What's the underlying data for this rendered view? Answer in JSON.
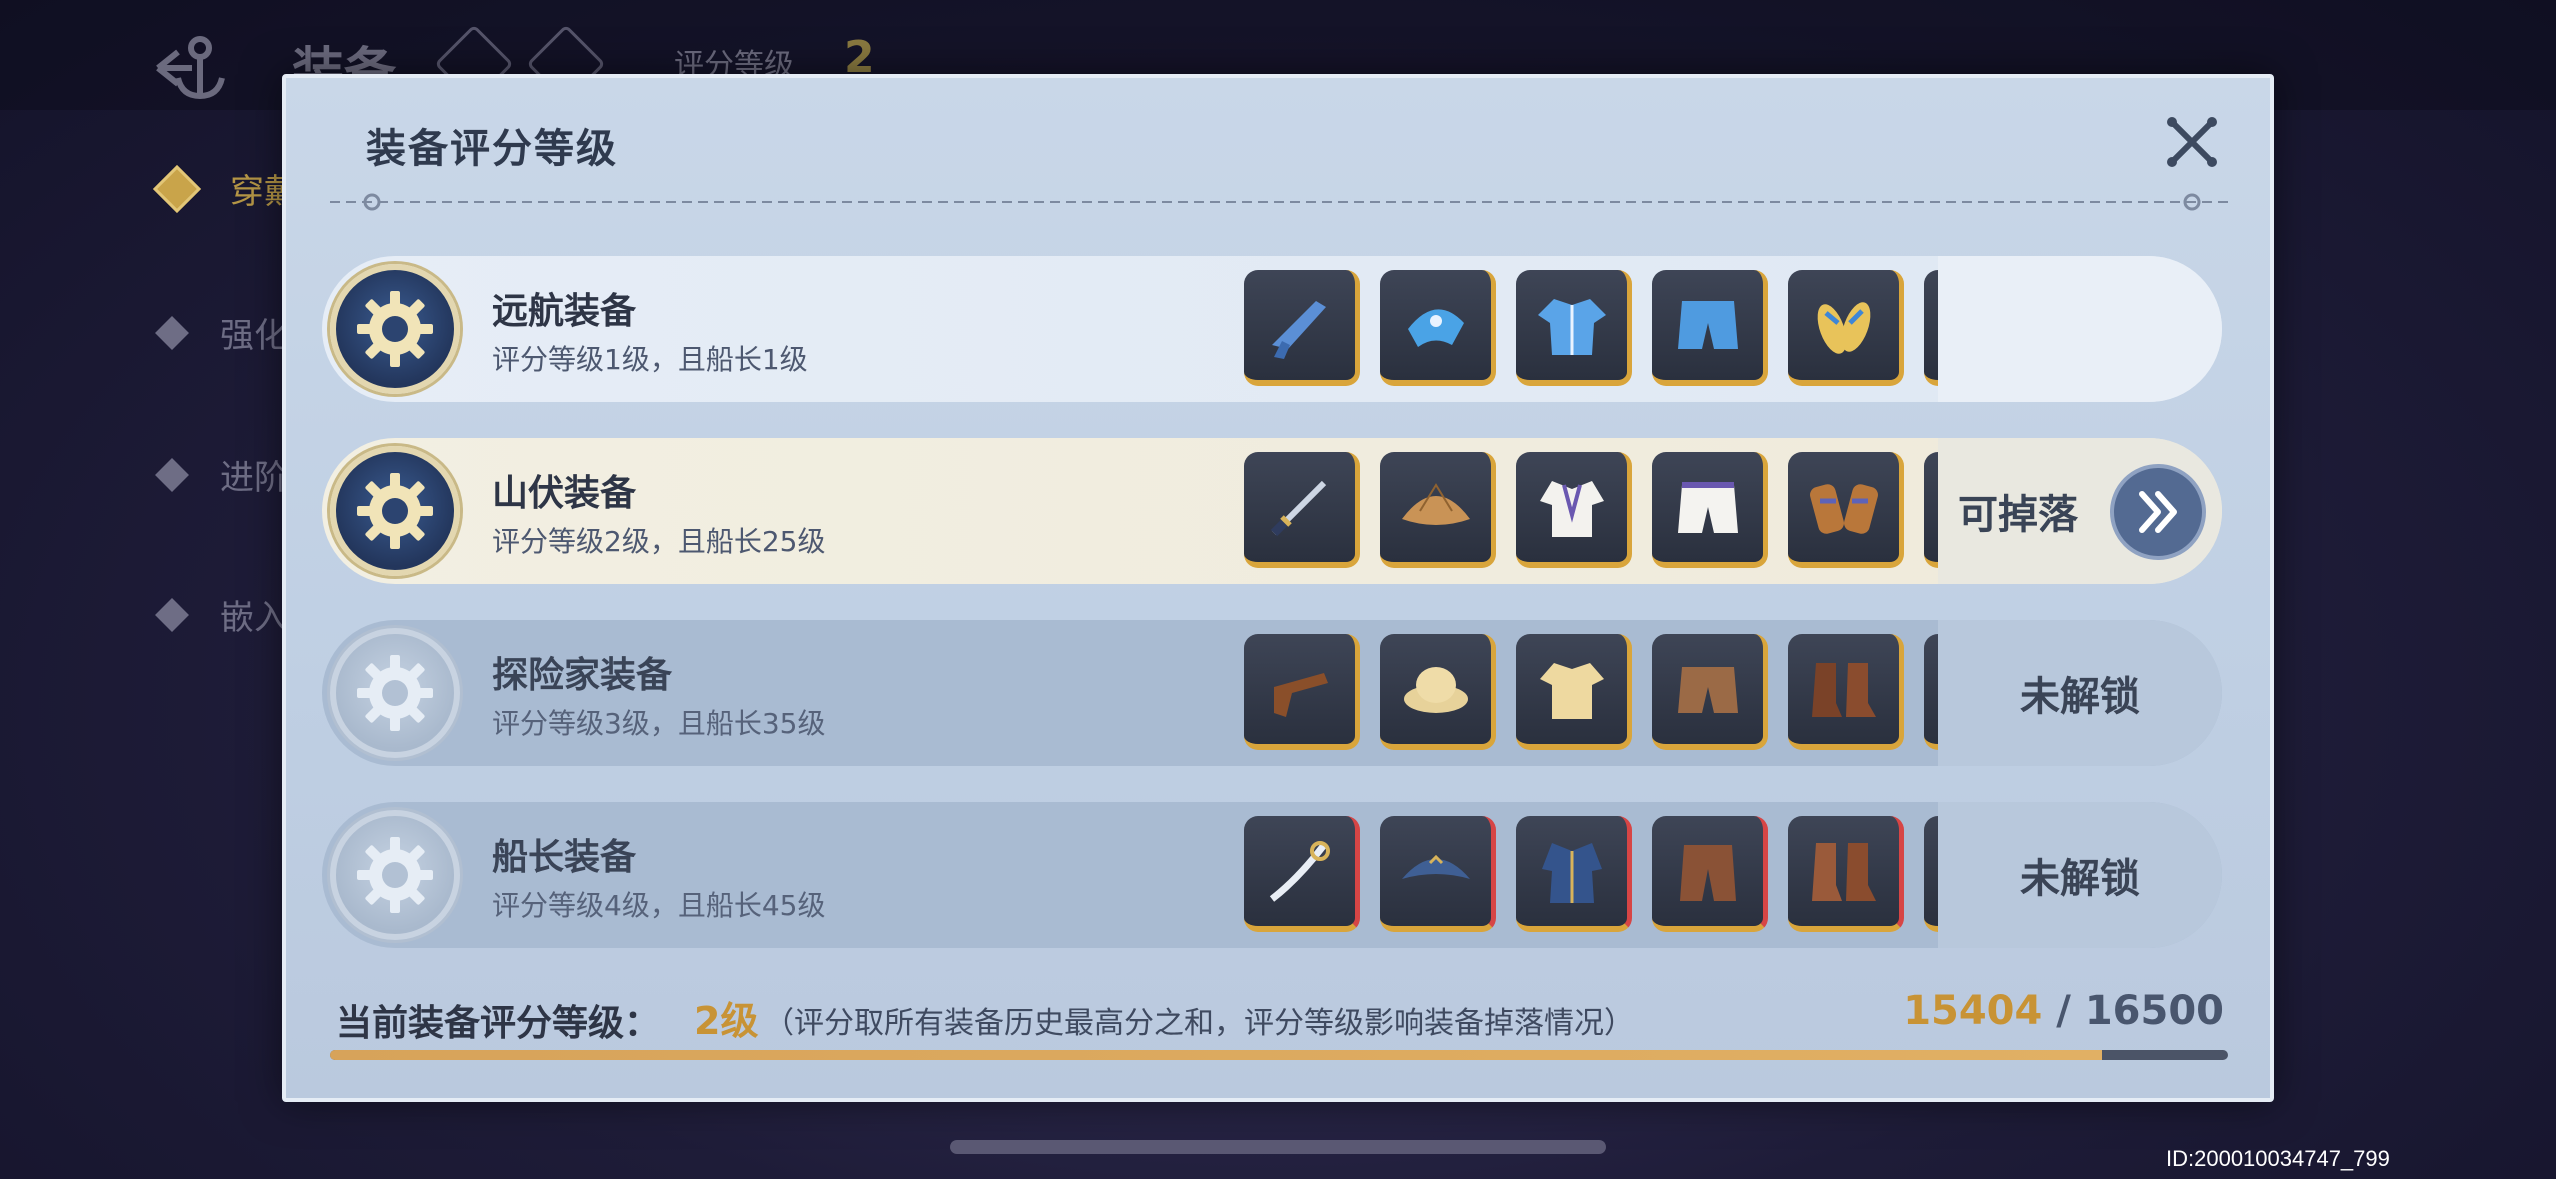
{
  "background": {
    "title": "装备",
    "score_label": "评分等级",
    "score_value": "2",
    "menu": [
      "穿戴",
      "强化",
      "进阶",
      "嵌入"
    ]
  },
  "modal": {
    "title": "装备评分等级",
    "rows": [
      {
        "name": "远航装备",
        "desc": "评分等级1级，且船长1级",
        "unlocked": true,
        "side_text": "",
        "items": [
          "flintlock-pistol-icon",
          "bandana-icon",
          "shirt-icon",
          "shorts-icon",
          "sandals-icon",
          "necklace-icon",
          "pendant-icon"
        ]
      },
      {
        "name": "山伏装备",
        "desc": "评分等级2级，且船长25级",
        "unlocked": true,
        "side_text": "可掉落",
        "items": [
          "sword-icon",
          "straw-hat-icon",
          "robe-icon",
          "pants-icon",
          "geta-icon",
          "bamboo-icon",
          "gauntlet-icon"
        ]
      },
      {
        "name": "探险家装备",
        "desc": "评分等级3级，且船长35级",
        "unlocked": false,
        "side_text": "未解锁",
        "items": [
          "pistol-icon",
          "explorer-hat-icon",
          "khaki-shirt-icon",
          "khaki-shorts-icon",
          "boots-icon",
          "goggles-icon",
          "pocket-watch-icon"
        ]
      },
      {
        "name": "船长装备",
        "desc": "评分等级4级，且船长45级",
        "unlocked": false,
        "side_text": "未解锁",
        "items": [
          "cutlass-icon",
          "tricorn-hat-icon",
          "captain-coat-icon",
          "captain-pants-icon",
          "captain-boots-icon",
          "spyglass-icon",
          "glove-icon"
        ]
      }
    ],
    "footer": {
      "label": "当前装备评分等级：",
      "level": "2级",
      "note": "（评分取所有装备历史最高分之和，评分等级影响装备掉落情况）",
      "score_current": "15404",
      "score_sep": " / ",
      "score_max": "16500",
      "progress_fraction": 0.9336
    }
  },
  "build_id": "ID:200010034747_799",
  "colors": {
    "accent_gold": "#c89335",
    "progress_fill": "#d7a35a"
  }
}
